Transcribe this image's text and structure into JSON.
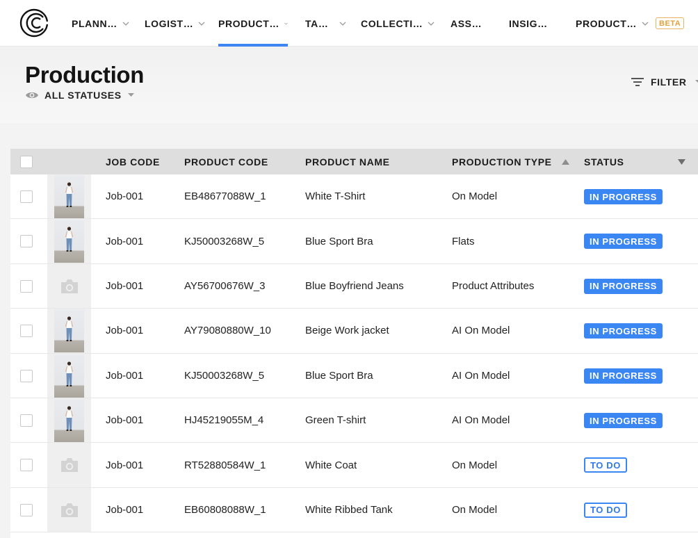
{
  "nav": {
    "items": [
      {
        "label": "PLANN…",
        "chevron": true
      },
      {
        "label": "LOGIST…",
        "chevron": true
      },
      {
        "label": "PRODUCT…",
        "chevron": true,
        "active": true
      },
      {
        "label": "TA…",
        "chevron": true
      },
      {
        "label": "COLLECTI…",
        "chevron": true
      },
      {
        "label": "ASS…",
        "chevron": false
      },
      {
        "label": "INSIG…",
        "chevron": false
      },
      {
        "label": "PRODUCT…",
        "chevron": true
      }
    ],
    "beta_label": "BETA",
    "accent": "#3d86f2",
    "beta_color": "#e2a13a"
  },
  "header": {
    "title": "Production",
    "status_filter_label": "ALL STATUSES",
    "filter_label": "FILTER"
  },
  "table": {
    "columns": {
      "job_code": "JOB CODE",
      "product_code": "PRODUCT CODE",
      "product_name": "PRODUCT NAME",
      "production_type": "PRODUCTION TYPE",
      "status": "STATUS"
    },
    "rows": [
      {
        "thumb": "photo",
        "job_code": "Job-001",
        "product_code": "EB48677088W_1",
        "product_name": "White T-Shirt",
        "production_type": "On Model",
        "status": "IN PROGRESS",
        "status_kind": "progress"
      },
      {
        "thumb": "photo",
        "job_code": "Job-001",
        "product_code": "KJ50003268W_5",
        "product_name": "Blue Sport Bra",
        "production_type": "Flats",
        "status": "IN PROGRESS",
        "status_kind": "progress"
      },
      {
        "thumb": "placeholder",
        "job_code": "Job-001",
        "product_code": "AY56700676W_3",
        "product_name": "Blue Boyfriend Jeans",
        "production_type": "Product Attributes",
        "status": "IN PROGRESS",
        "status_kind": "progress"
      },
      {
        "thumb": "photo",
        "job_code": "Job-001",
        "product_code": "AY79080880W_10",
        "product_name": "Beige Work jacket",
        "production_type": "AI On Model",
        "status": "IN PROGRESS",
        "status_kind": "progress"
      },
      {
        "thumb": "photo",
        "job_code": "Job-001",
        "product_code": "KJ50003268W_5",
        "product_name": "Blue Sport Bra",
        "production_type": "AI On Model",
        "status": "IN PROGRESS",
        "status_kind": "progress"
      },
      {
        "thumb": "photo",
        "job_code": "Job-001",
        "product_code": "HJ45219055M_4",
        "product_name": "Green T-shirt",
        "production_type": "AI On Model",
        "status": "IN PROGRESS",
        "status_kind": "progress"
      },
      {
        "thumb": "placeholder",
        "job_code": "Job-001",
        "product_code": "RT52880584W_1",
        "product_name": "White Coat",
        "production_type": "On Model",
        "status": "TO DO",
        "status_kind": "todo"
      },
      {
        "thumb": "placeholder",
        "job_code": "Job-001",
        "product_code": "EB60808088W_1",
        "product_name": "White Ribbed Tank",
        "production_type": "On Model",
        "status": "TO DO",
        "status_kind": "todo"
      }
    ]
  }
}
